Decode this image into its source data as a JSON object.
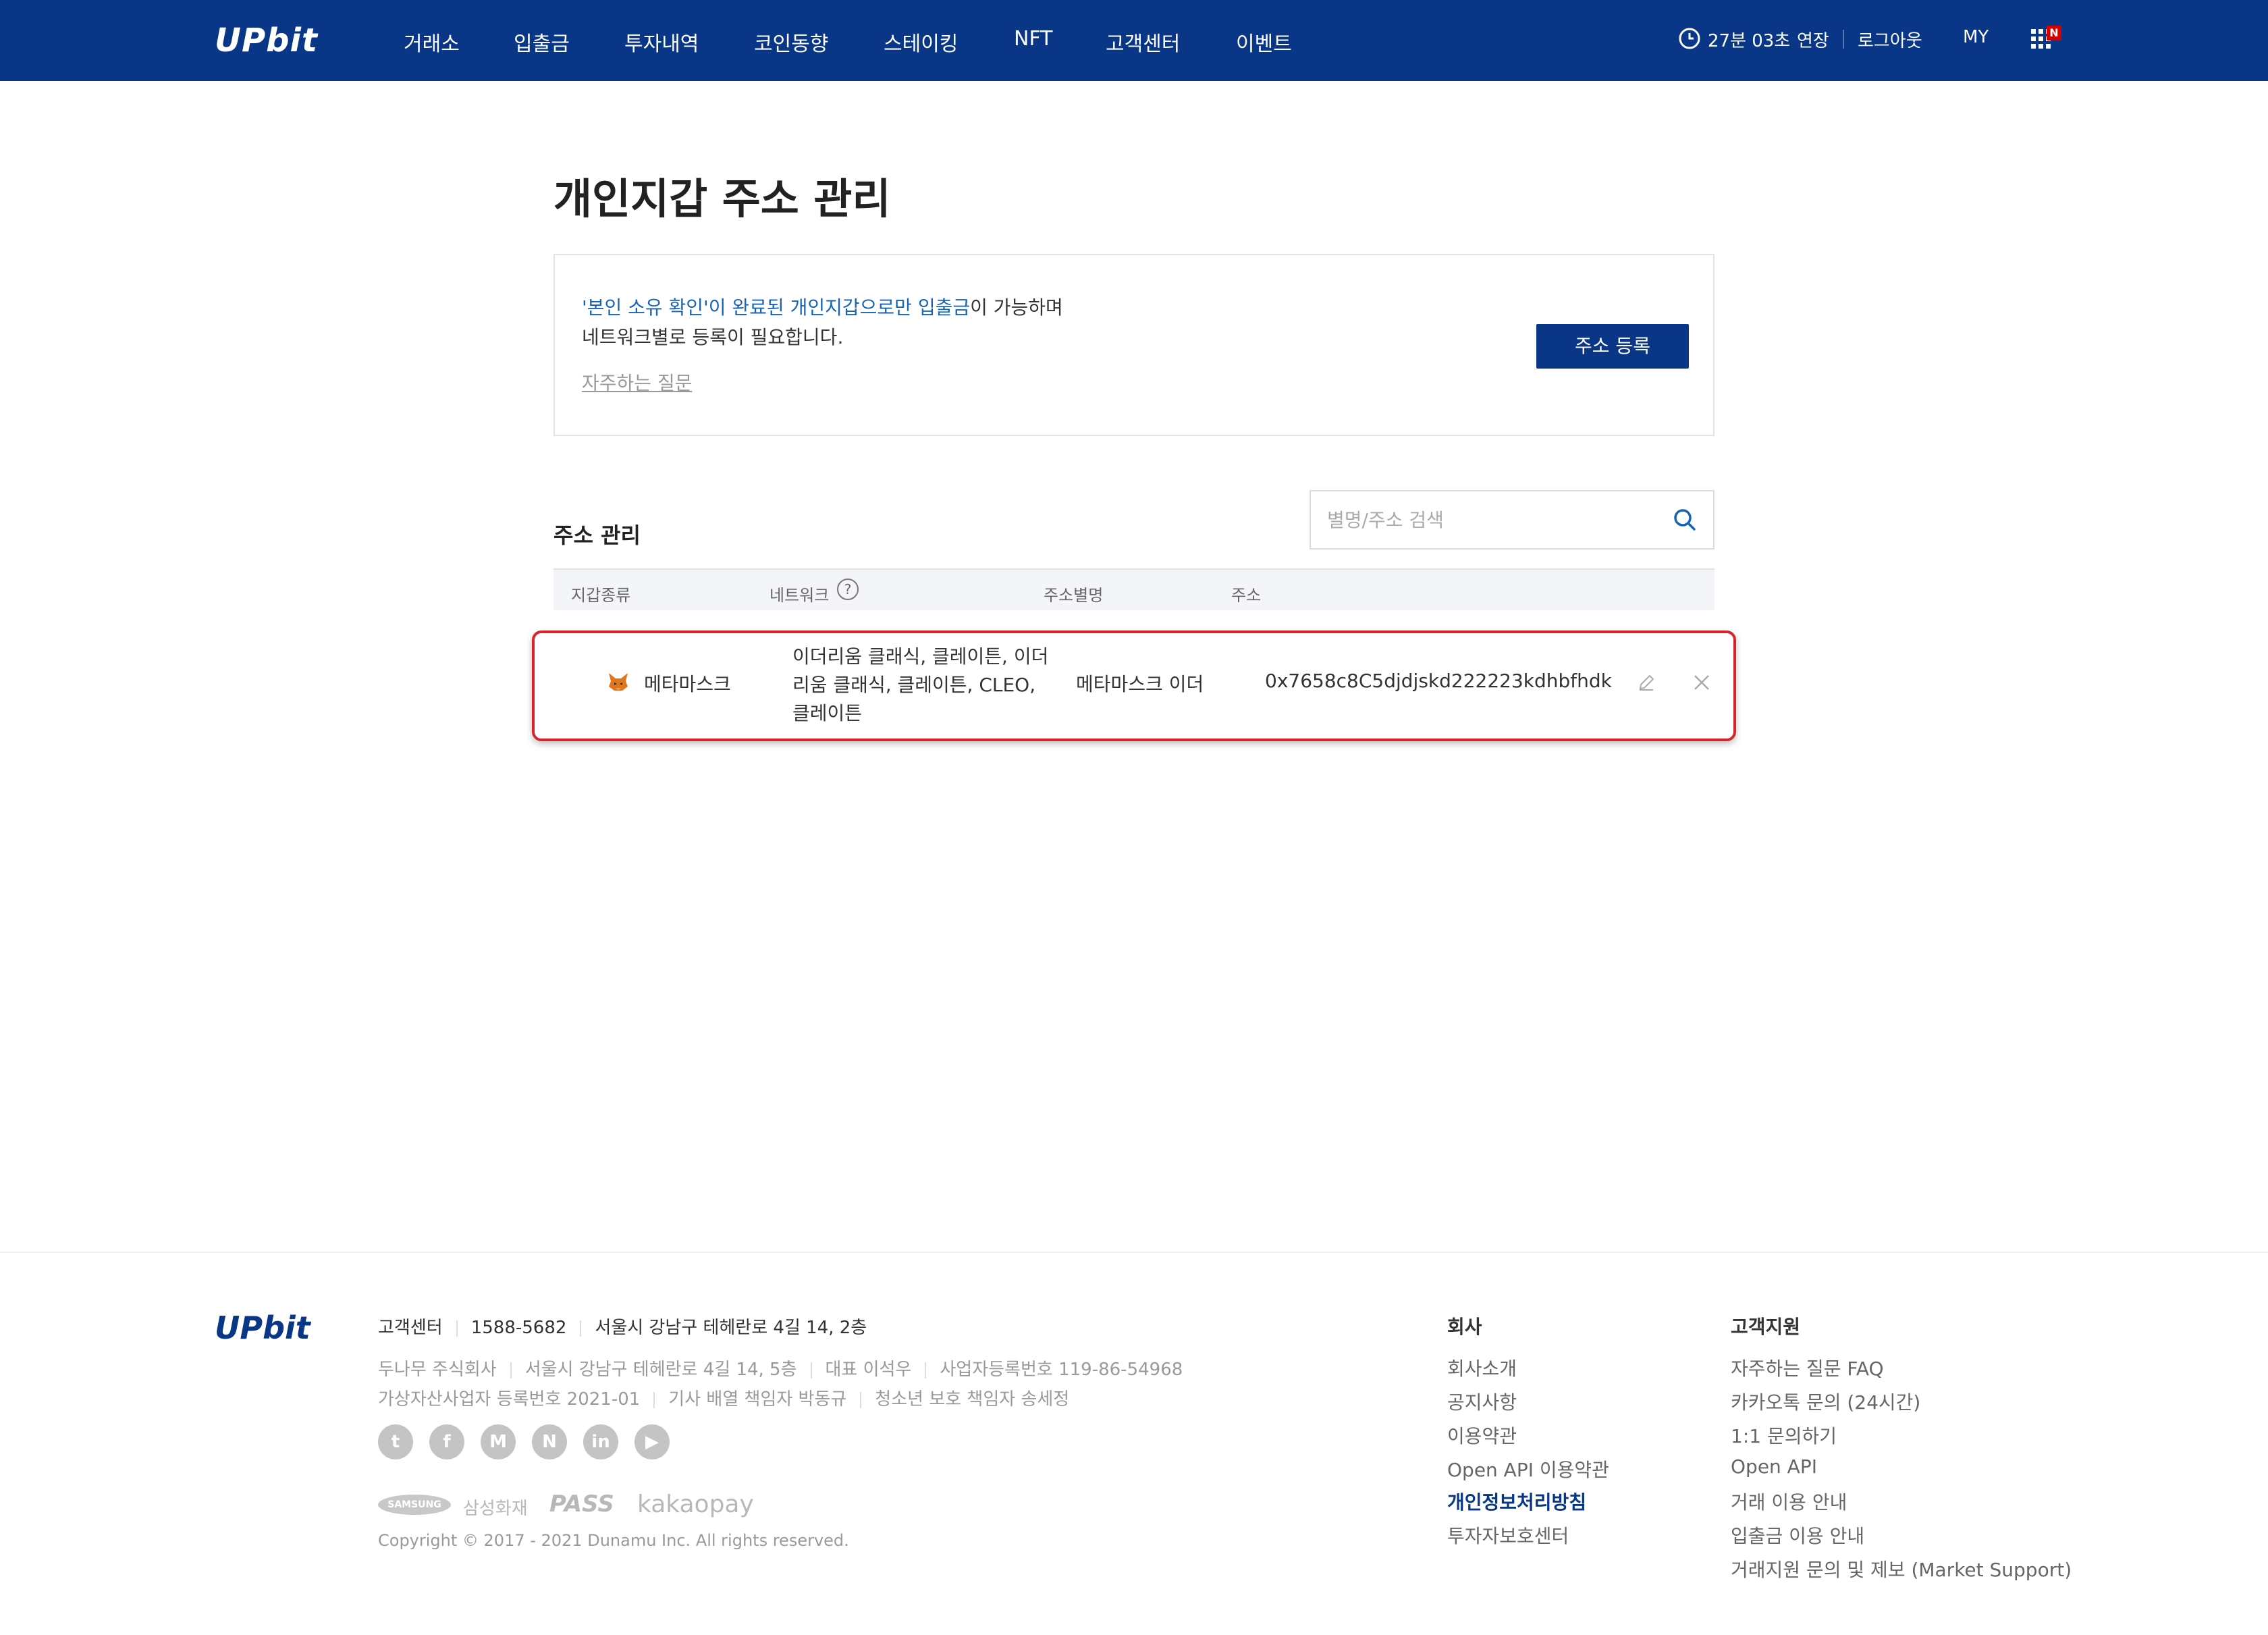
{
  "header": {
    "logo": "UPbit",
    "nav": [
      "거래소",
      "입출금",
      "투자내역",
      "코인동향",
      "스테이킹",
      "NFT",
      "고객센터",
      "이벤트"
    ],
    "session_timer": "27분 03초",
    "extend_label": "연장",
    "logout_label": "로그아웃",
    "my_label": "MY",
    "badge": "N",
    "colors": {
      "header_bg": "#093687",
      "badge": "#d60000"
    }
  },
  "main": {
    "title": "개인지갑 주소 관리",
    "notice": {
      "line1_blue_a": "'본인 소유 확인'이 완료된 개인지갑으로만 입출금",
      "line1_rest": "이 가능하며",
      "line2": "네트워크별로 등록이 필요합니다.",
      "faq_link": "자주하는 질문",
      "register_button": "주소 등록"
    },
    "section_title": "주소 관리",
    "search": {
      "placeholder": "별명/주소 검색",
      "value": ""
    },
    "table": {
      "headers": [
        "지갑종류",
        "네트워크",
        "주소별명",
        "주소"
      ],
      "help_icon": "?",
      "rows": [
        {
          "wallet": "메타마스크",
          "network": "이더리움 클래식, 클레이튼, 이더리움 클래식, 클레이튼, CLEO, 클레이튼",
          "alias": "메타마스크 이더",
          "address": "0x7658c8C5djdjskd222223kdhbfhdk"
        }
      ]
    },
    "colors": {
      "highlight_border": "#d9232b",
      "accent_blue": "#1763b6"
    }
  },
  "footer": {
    "logo": "UPbit",
    "cs_label": "고객센터",
    "cs_phone": "1588-5682",
    "cs_address": "서울시 강남구 테헤란로 4길 14, 2층",
    "company_line": [
      "두나무 주식회사",
      "서울시 강남구 테헤란로 4길 14, 5층",
      "대표 이석우",
      "사업자등록번호 119-86-54968"
    ],
    "registry_line": [
      "가상자산사업자 등록번호 2021-01",
      "기사 배열 책임자 박동규",
      "청소년 보호 책임자 송세정"
    ],
    "social_icons": [
      "twitter-icon",
      "facebook-icon",
      "medium-icon",
      "naver-icon",
      "linkedin-icon",
      "youtube-icon"
    ],
    "social_glyphs": [
      "t",
      "f",
      "M",
      "N",
      "in",
      "▶"
    ],
    "partners": [
      "SAMSUNG",
      "삼성화재",
      "PASS",
      "kakaopay"
    ],
    "copyright": "Copyright © 2017 - 2021 Dunamu Inc. All rights reserved.",
    "company_col": {
      "title": "회사",
      "links": [
        "회사소개",
        "공지사항",
        "이용약관",
        "Open API 이용약관",
        "개인정보처리방침",
        "투자자보호센터"
      ]
    },
    "support_col": {
      "title": "고객지원",
      "links": [
        "자주하는 질문 FAQ",
        "카카오톡 문의 (24시간)",
        "1:1 문의하기",
        "Open API",
        "거래 이용 안내",
        "입출금 이용 안내",
        "거래지원 문의 및 제보 (Market Support)"
      ]
    }
  }
}
